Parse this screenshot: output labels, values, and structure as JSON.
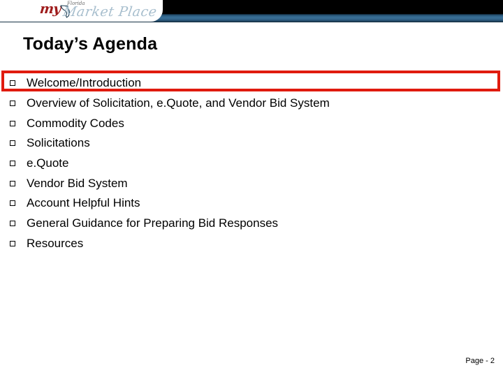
{
  "slide": {
    "title": "Today’s Agenda",
    "page_label": "Page - 2"
  },
  "logo": {
    "my_text": "my",
    "florida_text": "Florida",
    "market_place_text": "Market Place",
    "my_color": "#9e1b1b",
    "market_place_color": "#a8bfce",
    "panel_background": "#ffffff"
  },
  "header": {
    "background_color": "#000000",
    "stripe_color": "#3a7098"
  },
  "highlight": {
    "color": "#e01b0e",
    "target_index": 0
  },
  "agenda": {
    "bullet_glyph": "square-outline",
    "items": [
      {
        "label": "Welcome/Introduction"
      },
      {
        "label": "Overview of Solicitation, e.Quote, and Vendor Bid System"
      },
      {
        "label": "Commodity Codes"
      },
      {
        "label": "Solicitations"
      },
      {
        "label": "e.Quote"
      },
      {
        "label": "Vendor Bid System"
      },
      {
        "label": "Account Helpful Hints"
      },
      {
        "label": "General Guidance for Preparing Bid Responses"
      },
      {
        "label": "Resources"
      }
    ]
  }
}
